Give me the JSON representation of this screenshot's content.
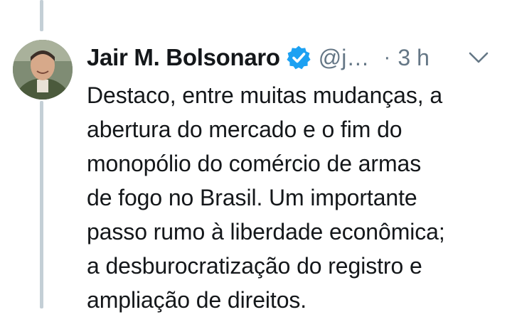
{
  "tweet": {
    "author": {
      "display_name": "Jair M. Bolsonaro",
      "handle": "@j…",
      "verified": true,
      "avatar": "profile-photo"
    },
    "separator": "·",
    "timestamp": "3 h",
    "text_lines": [
      "Destaco, entre muitas mudanças, a",
      "abertura do mercado e o fim do",
      "monopólio do comércio de armas",
      "de fogo no Brasil. Um importante",
      "passo rumo à liberdade econômica;",
      "a desburocratização do registro e",
      "ampliação de direitos."
    ]
  },
  "icons": {
    "verified": "verified-badge-icon",
    "menu": "chevron-down-icon"
  },
  "colors": {
    "verified_blue": "#1da1f2",
    "secondary_text": "#657786",
    "primary_text": "#14171a",
    "thread_line": "#c4cfd6"
  }
}
